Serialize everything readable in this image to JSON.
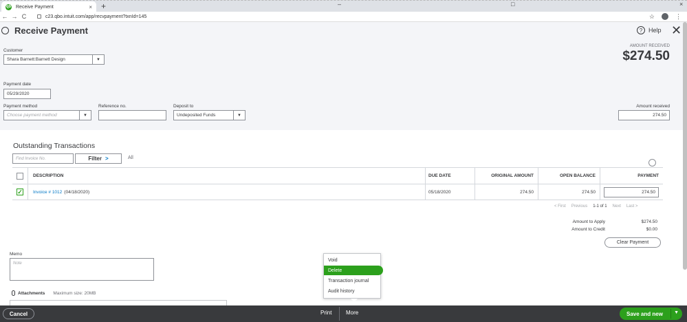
{
  "browser": {
    "tab_title": "Receive Payment",
    "tab_close": "×",
    "new_tab": "+",
    "win_minimize": "–",
    "win_maximize": "□",
    "win_close": "×",
    "url": "c23.qbo.intuit.com/app/recvpayment?txnId=145",
    "back": "←",
    "forward": "→",
    "reload": "C",
    "star": "☆",
    "menu": "⋮"
  },
  "header": {
    "title": "Receive Payment",
    "help_label": "Help",
    "help_glyph": "?",
    "close_glyph": "✕",
    "amount_received_label": "AMOUNT RECEIVED",
    "amount_received_value": "$274.50"
  },
  "form": {
    "customer_label": "Customer",
    "customer_value": "Shara Barnett:Barnett Design",
    "payment_date_label": "Payment date",
    "payment_date_value": "05/29/2020",
    "payment_method_label": "Payment method",
    "payment_method_placeholder": "Choose payment method",
    "reference_label": "Reference no.",
    "reference_value": "",
    "deposit_label": "Deposit to",
    "deposit_value": "Undeposited Funds",
    "amount_received_field_label": "Amount received",
    "amount_received_field_value": "274.50",
    "caret": "▼"
  },
  "outstanding": {
    "title": "Outstanding Transactions",
    "find_placeholder": "Find Invoice No.",
    "filter_label": "Filter",
    "filter_chev": ">",
    "all_label": "All",
    "columns": {
      "description": "DESCRIPTION",
      "due_date": "DUE DATE",
      "original_amount": "ORIGINAL AMOUNT",
      "open_balance": "OPEN BALANCE",
      "payment": "PAYMENT"
    },
    "rows": [
      {
        "checked": true,
        "invoice_link": "Invoice # 1012",
        "invoice_date": "(04/18/2020)",
        "due_date": "05/18/2020",
        "original_amount": "274.50",
        "open_balance": "274.50",
        "payment": "274.50"
      }
    ],
    "pager": {
      "first": "< First",
      "previous": "Previous",
      "range": "1-1 of 1",
      "next": "Next",
      "last": "Last >"
    },
    "amount_to_apply_label": "Amount to Apply",
    "amount_to_apply_value": "$274.50",
    "amount_to_credit_label": "Amount to Credit",
    "amount_to_credit_value": "$0.00",
    "clear_payment_label": "Clear Payment"
  },
  "memo": {
    "label": "Memo",
    "placeholder": "Note"
  },
  "attachments": {
    "label": "Attachments",
    "max_size": "Maximum size: 20MB"
  },
  "more_menu": {
    "items": [
      "Void",
      "Delete",
      "Transaction journal",
      "Audit history"
    ],
    "highlighted_index": 1
  },
  "footer": {
    "cancel_label": "Cancel",
    "print_label": "Print",
    "more_label": "More",
    "save_label": "Save and new",
    "save_caret": "▼"
  },
  "colors": {
    "brand_green": "#2ca01c",
    "link_blue": "#0077c5",
    "footer_bg": "#393a3d"
  }
}
